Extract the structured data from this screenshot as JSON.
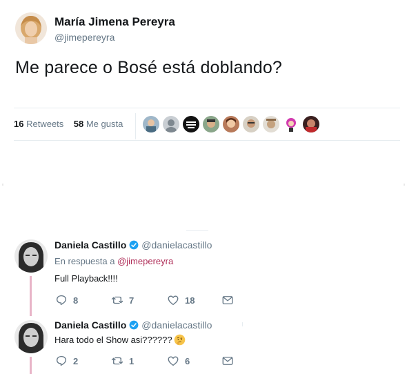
{
  "tweet": {
    "author_name": "María Jimena Pereyra",
    "author_handle": "@jimepereyra",
    "text": "Me parece o Bosé está doblando?",
    "retweets_count": "16",
    "retweets_label": "Retweets",
    "likes_count": "58",
    "likes_label": "Me gusta",
    "liker_avatars": [
      "liker-avatar-1",
      "liker-avatar-2",
      "liker-avatar-3",
      "liker-avatar-4",
      "liker-avatar-5",
      "liker-avatar-6",
      "liker-avatar-7",
      "liker-avatar-8",
      "liker-avatar-9"
    ]
  },
  "replies": [
    {
      "author_name": "Daniela Castillo",
      "author_handle": "@danielacastillo",
      "in_reply_prefix": "En respuesta a",
      "in_reply_handle": "@jimepereyra",
      "text": "Full Playback!!!!",
      "replies": "8",
      "retweets": "7",
      "likes": "18"
    },
    {
      "author_name": "Daniela Castillo",
      "author_handle": "@danielacastillo",
      "text": "Hara todo el Show asi??????",
      "emoji": "thinking-face-emoji",
      "replies": "2",
      "retweets": "1",
      "likes": "6"
    }
  ],
  "colors": {
    "text": "#14171a",
    "secondary": "#657786",
    "link": "#b0305a",
    "verified": "#1da1f2",
    "thread_line": "#e8b4c8",
    "divider": "#e6ecf0"
  }
}
